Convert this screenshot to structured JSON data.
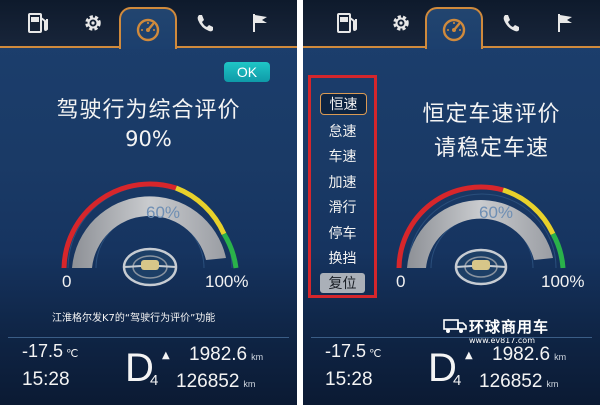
{
  "colors": {
    "accent_orange": "#d08a3c",
    "ok_teal": "#17b3bd",
    "gauge_red": "#d7262b",
    "gauge_yellow": "#e8d12b",
    "gauge_green": "#2ab24a",
    "menu_border_red": "#d4262c"
  },
  "tabs": [
    {
      "icon": "fuel-pump-icon"
    },
    {
      "icon": "gear-icon"
    },
    {
      "icon": "speedometer-icon",
      "active": true
    },
    {
      "icon": "phone-icon"
    },
    {
      "icon": "flag-icon"
    }
  ],
  "left_screen": {
    "ok_label": "OK",
    "title": "驾驶行为综合评价",
    "score": "90%",
    "gauge": {
      "min_label": "0",
      "max_label": "100%",
      "value_label": "60%",
      "value": 60
    },
    "caption": "江淮格尔发K7的“驾驶行为评价”功能"
  },
  "right_screen": {
    "title_line1": "恒定车速评价",
    "title_line2": "请稳定车速",
    "menu": [
      "恒速",
      "怠速",
      "车速",
      "加速",
      "滑行",
      "停车",
      "换挡"
    ],
    "menu_reset": "复位",
    "gauge": {
      "min_label": "0",
      "max_label": "100%",
      "value_label": "60%",
      "value": 60
    },
    "watermark_name": "环球商用车",
    "watermark_url": "www.ev817.com"
  },
  "status": {
    "temperature": "-17.5",
    "temperature_unit": "℃",
    "time": "15:28",
    "gear": "D",
    "gear_sub": "4",
    "trip": "1982.6",
    "odometer": "126852",
    "distance_unit": "km"
  }
}
